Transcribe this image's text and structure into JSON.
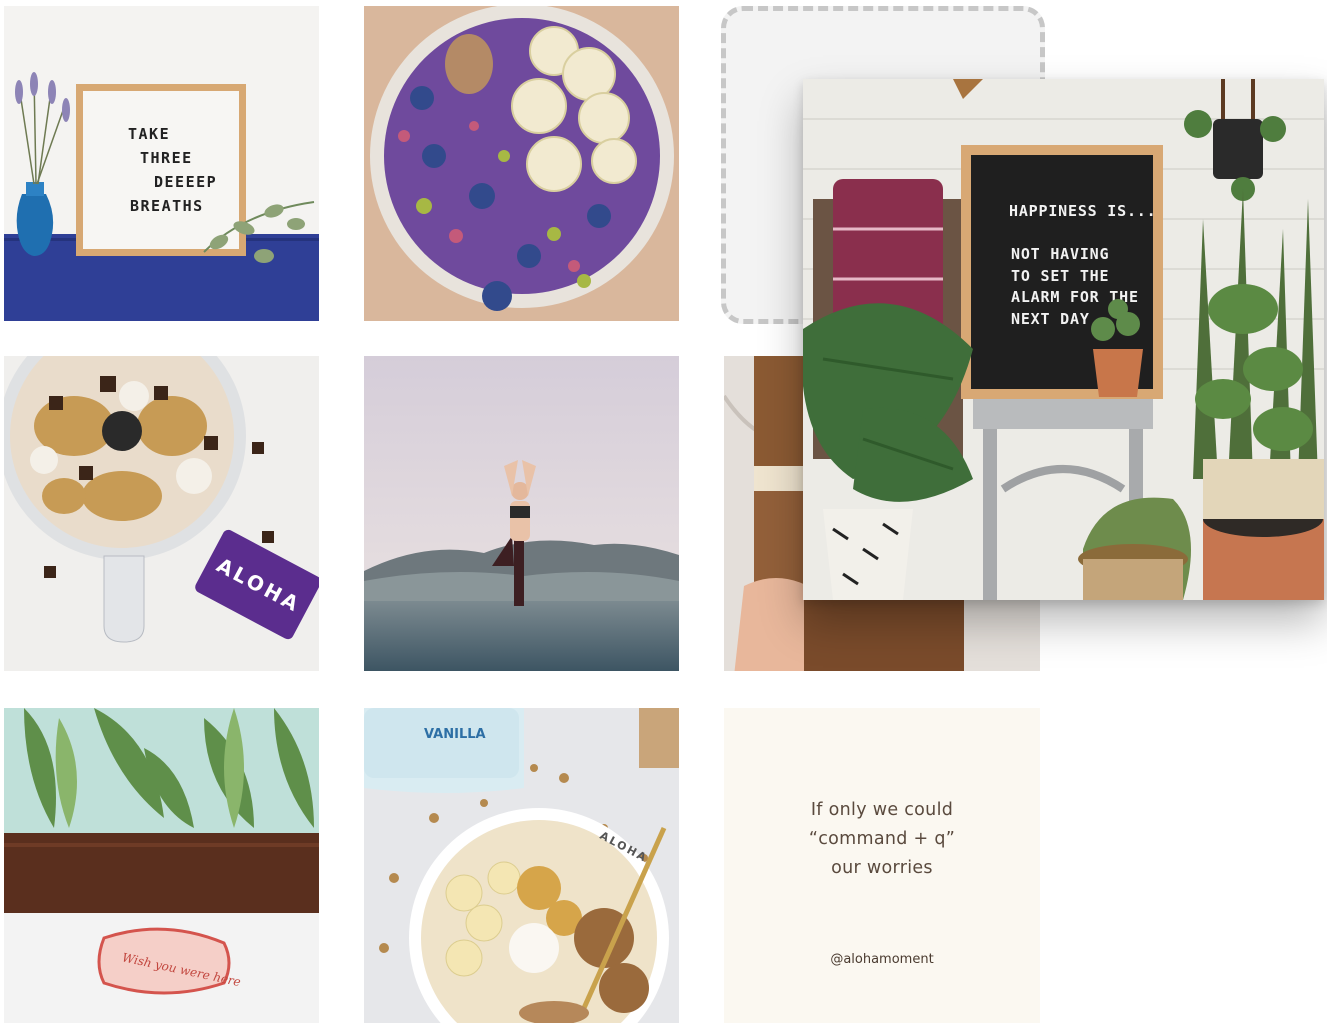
{
  "grid": {
    "tile1": {
      "lines": [
        "TAKE",
        "THREE",
        "DEEEEP",
        "BREATHS"
      ],
      "kind": "letterboard-photo"
    },
    "tile2": {
      "kind": "smoothie-bowl-photo"
    },
    "tile4": {
      "kind": "food-processor-photo",
      "brand_text": "ALOHA"
    },
    "tile5": {
      "kind": "yoga-photo"
    },
    "tile6": {
      "kind": "snack-bar-photo"
    },
    "tile7": {
      "kind": "sleep-mask-photo",
      "mask_text": "Wish you were here"
    },
    "tile8": {
      "kind": "oatmeal-bowl-photo",
      "jar_text": "VANILLA",
      "bowl_text": "ALOHA"
    },
    "tile9": {
      "kind": "quote-card",
      "quote": "If only we could\n“command + q”\nour worries",
      "handle": "@alohamoment"
    }
  },
  "dragged_tile": {
    "kind": "letterboard-plants-photo",
    "lines": [
      "HAPPINESS IS...",
      "NOT HAVING",
      "TO SET THE",
      "ALARM FOR THE",
      "NEXT DAY"
    ]
  },
  "colors": {
    "quote_bg": "#fbf8f1",
    "quote_text": "#5a4a3e",
    "placeholder_border": "#c7c7c7"
  }
}
